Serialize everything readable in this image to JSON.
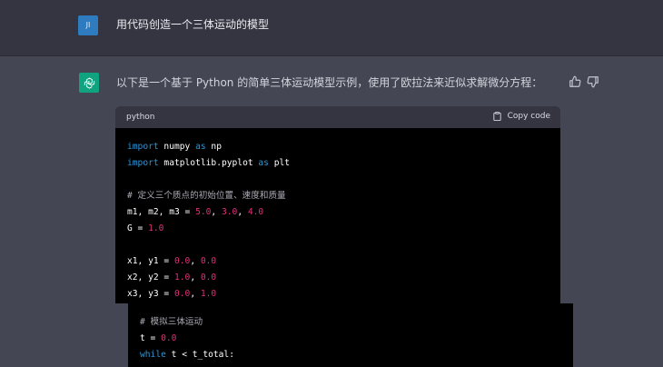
{
  "user": {
    "avatar_initials": "JI",
    "message": "用代码创造一个三体运动的模型"
  },
  "assistant": {
    "avatar_icon": "openai-logo-icon",
    "message": "以下是一个基于 Python 的简单三体运动模型示例，使用了欧拉法来近似求解微分方程：",
    "feedback_icons": [
      "thumbs-up-icon",
      "thumbs-down-icon"
    ]
  },
  "code_block": {
    "language": "python",
    "copy_label": "Copy code",
    "lines": {
      "l1_kw": "import",
      "l1_rest": " numpy ",
      "l1_kw2": "as",
      "l1_end": " np",
      "l2_kw": "import",
      "l2_rest": " matplotlib.pyplot ",
      "l2_kw2": "as",
      "l2_end": " plt",
      "l3_comment": "# 定义三个质点的初始位置、速度和质量",
      "l4_a": "m1, m2, m3 = ",
      "l4_n1": "5.0",
      "l4_c1": ", ",
      "l4_n2": "3.0",
      "l4_c2": ", ",
      "l4_n3": "4.0",
      "l5_a": "G = ",
      "l5_n": "1.0",
      "l6_a": "x1, y1 = ",
      "l6_n1": "0.0",
      "l6_c": ", ",
      "l6_n2": "0.0",
      "l7_a": "x2, y2 = ",
      "l7_n1": "1.0",
      "l7_c": ", ",
      "l7_n2": "0.0",
      "l8_a": "x3, y3 = ",
      "l8_n1": "0.0",
      "l8_c": ", ",
      "l8_n2": "1.0",
      "l9_comment": "# 模拟三体运动",
      "l10_a": "t = ",
      "l10_n": "0.0",
      "l11_kw": "while",
      "l11_rest": " t < t_total:"
    }
  },
  "colors": {
    "page_bg": "#444654",
    "user_row_bg": "#343541",
    "code_bg": "#000000",
    "keyword": "#2e95d3",
    "number": "#df3079",
    "comment": "#a9a9b3",
    "assistant_avatar": "#10a37f",
    "user_avatar": "#2f7bbf"
  }
}
